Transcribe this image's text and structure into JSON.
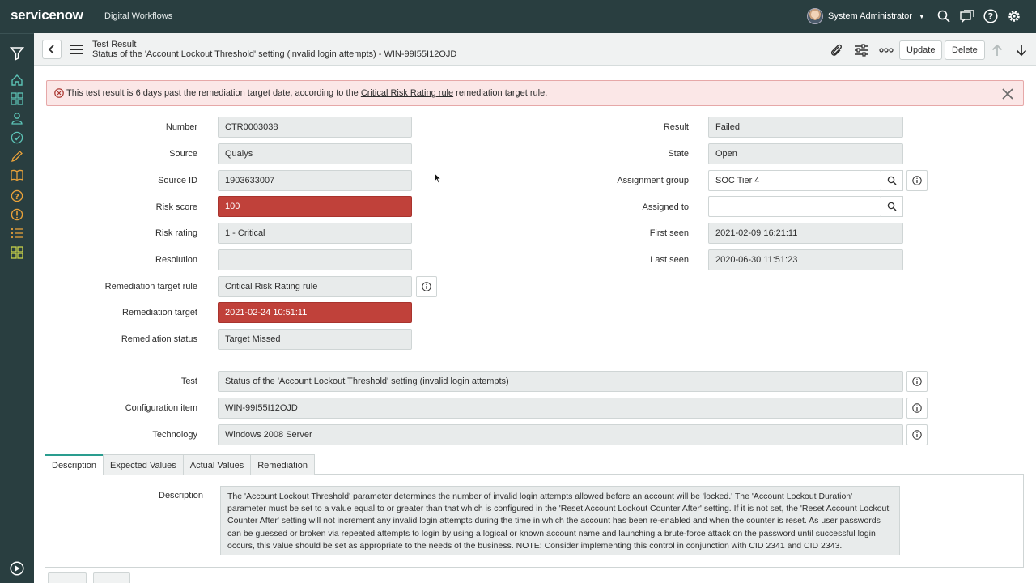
{
  "banner": {
    "logo": "servicenow",
    "subtitle": "Digital Workflows",
    "user_name": "System Administrator",
    "icons": [
      "search-icon",
      "chat-icon",
      "help-icon",
      "gear-icon"
    ]
  },
  "leftnav": {
    "icons": [
      "filter-icon",
      "home-icon",
      "grid-icon",
      "user-icon",
      "check-circle-icon",
      "pencil-icon",
      "book-icon",
      "question-icon",
      "alert-icon",
      "list-icon",
      "dashboard-icon",
      "play-icon"
    ]
  },
  "header": {
    "title": "Test Result",
    "subtitle": "Status of the 'Account Lockout Threshold' setting (invalid login attempts) - WIN-99I55I12OJD",
    "update_label": "Update",
    "delete_label": "Delete"
  },
  "alert": {
    "text_before": "This test result is 6 days past the remediation target date, according to the ",
    "link_text": "Critical Risk Rating rule",
    "text_after": " remediation target rule."
  },
  "left_fields": [
    {
      "label": "Number",
      "value": "CTR0003038"
    },
    {
      "label": "Source",
      "value": "Qualys"
    },
    {
      "label": "Source ID",
      "value": "1903633007"
    },
    {
      "label": "Risk score",
      "value": "100"
    },
    {
      "label": "Risk rating",
      "value": "1 - Critical"
    },
    {
      "label": "Resolution",
      "value": ""
    },
    {
      "label": "Remediation target rule",
      "value": "Critical Risk Rating rule"
    },
    {
      "label": "Remediation target",
      "value": "2021-02-24 10:51:11"
    },
    {
      "label": "Remediation status",
      "value": "Target Missed"
    }
  ],
  "right_fields": [
    {
      "label": "Result",
      "value": "Failed"
    },
    {
      "label": "State",
      "value": "Open"
    },
    {
      "label": "Assignment group",
      "value": "SOC Tier 4"
    },
    {
      "label": "Assigned to",
      "value": ""
    },
    {
      "label": "First seen",
      "value": "2021-02-09 16:21:11"
    },
    {
      "label": "Last seen",
      "value": "2020-06-30 11:51:23"
    }
  ],
  "wide_fields": [
    {
      "label": "Test",
      "value": "Status of the 'Account Lockout Threshold' setting (invalid login attempts)"
    },
    {
      "label": "Configuration item",
      "value": "WIN-99I55I12OJD"
    },
    {
      "label": "Technology",
      "value": "Windows 2008 Server"
    }
  ],
  "tabs": [
    "Description",
    "Expected Values",
    "Actual Values",
    "Remediation"
  ],
  "description": {
    "label": "Description",
    "text": "The 'Account Lockout Threshold' parameter determines the number of invalid login attempts allowed before an account will be 'locked.'  The 'Account Lockout Duration' parameter must be set to a value equal to or greater than that which is configured in the 'Reset Account Lockout Counter After' setting.  If it is not set, the 'Reset Account Lockout Counter After' setting will not increment any invalid login attempts during the time in which the account has been re-enabled and when the counter is reset.  As user passwords can be guessed or broken via repeated attempts to login by using a logical or known account name and launching a brute-force attack on the password until successful login occurs, this value should be set as appropriate to the needs of the business.  NOTE: Consider implementing this control in conjunction with CID 2341 and CID 2343."
  },
  "colors": {
    "banner": "#293e40",
    "critical": "#c0413a",
    "alert_bg": "#fbe7e7",
    "tab_accent": "#2a9d8f"
  }
}
